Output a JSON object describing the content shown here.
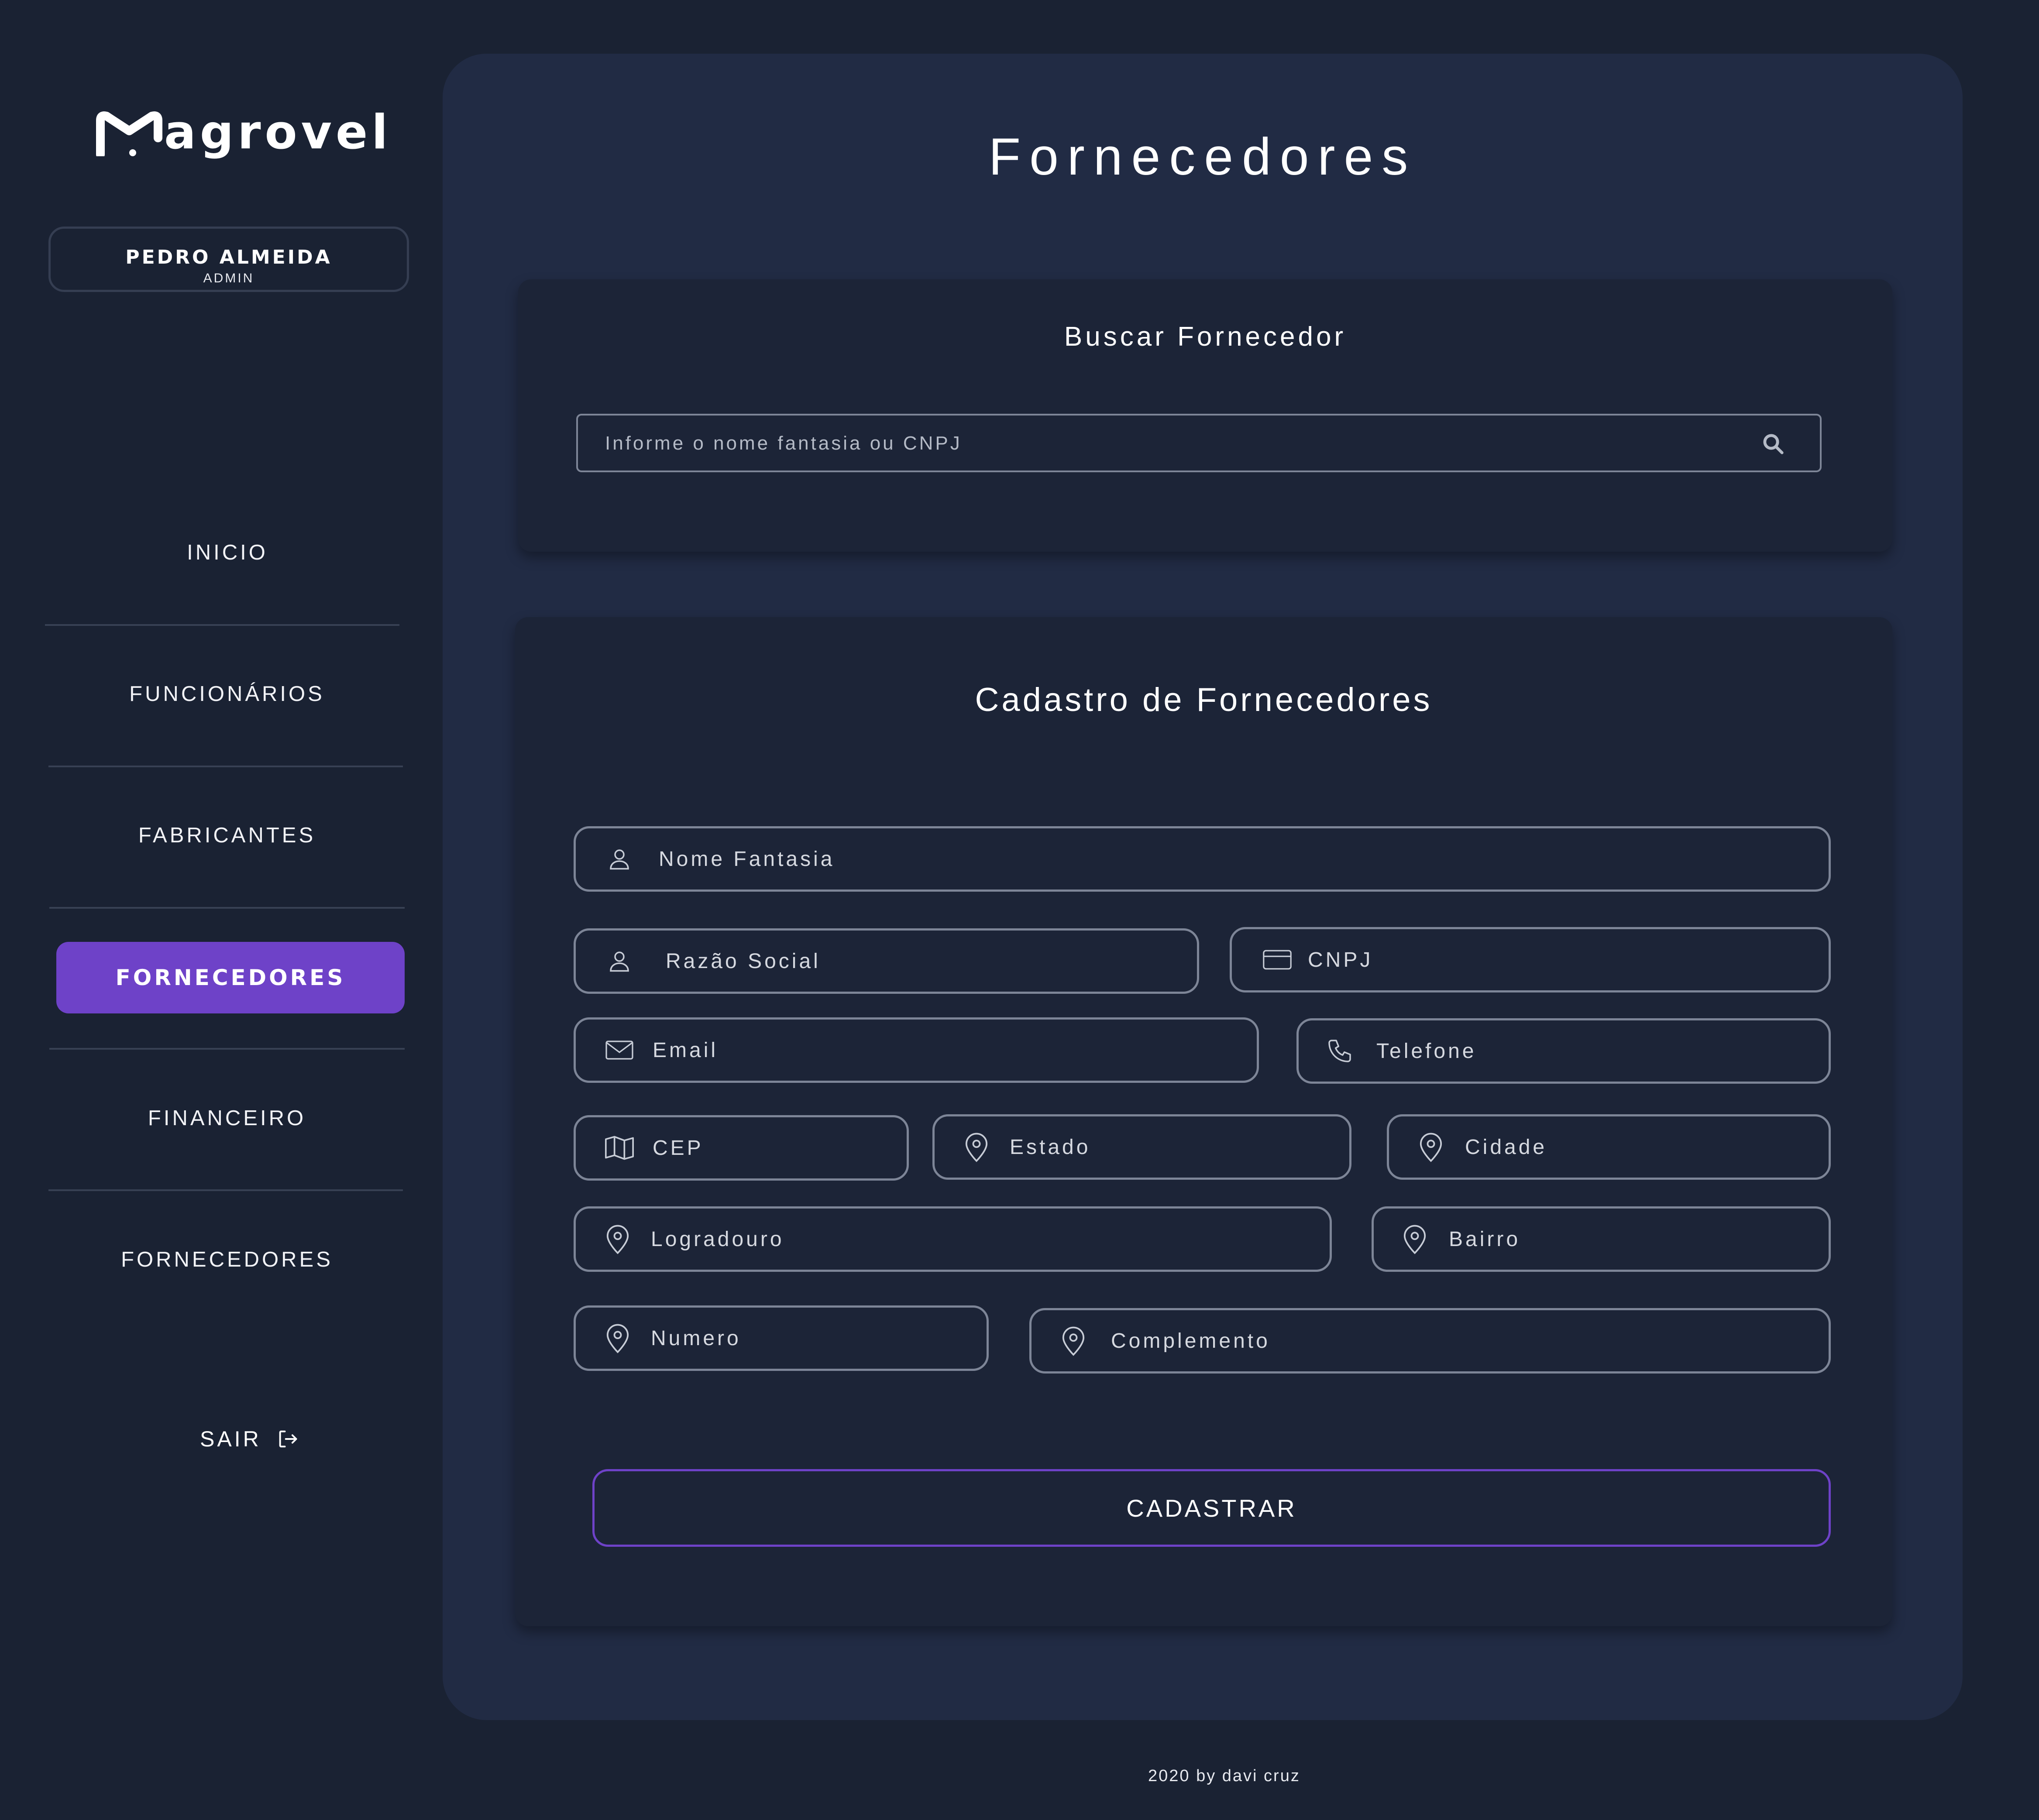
{
  "app": {
    "brand": "agrovel"
  },
  "user": {
    "name": "PEDRO ALMEIDA",
    "role": "ADMIN"
  },
  "sidebar": {
    "items": [
      {
        "label": "INICIO",
        "active": false
      },
      {
        "label": "FUNCIONÁRIOS",
        "active": false
      },
      {
        "label": "FABRICANTES",
        "active": false
      },
      {
        "label": "FORNECEDORES",
        "active": true
      },
      {
        "label": "FINANCEIRO",
        "active": false
      },
      {
        "label": "FORNECEDORES",
        "active": false
      }
    ],
    "logout_label": "SAIR",
    "active_color": "#6e42c8"
  },
  "page": {
    "title": "Fornecedores"
  },
  "search": {
    "title": "Buscar Fornecedor",
    "placeholder": "Informe o nome fantasia ou CNPJ",
    "value": ""
  },
  "form": {
    "title": "Cadastro de Fornecedores",
    "fields": {
      "nome_fantasia": {
        "placeholder": "Nome Fantasia",
        "icon": "user-icon"
      },
      "razao_social": {
        "placeholder": "Razão Social",
        "icon": "user-icon"
      },
      "cnpj": {
        "placeholder": "CNPJ",
        "icon": "card-icon"
      },
      "email": {
        "placeholder": "Email",
        "icon": "mail-icon"
      },
      "telefone": {
        "placeholder": "Telefone",
        "icon": "phone-icon"
      },
      "cep": {
        "placeholder": "CEP",
        "icon": "map-icon"
      },
      "estado": {
        "placeholder": "Estado",
        "icon": "location-pin-icon"
      },
      "cidade": {
        "placeholder": "Cidade",
        "icon": "location-pin-icon"
      },
      "logradouro": {
        "placeholder": "Logradouro",
        "icon": "location-pin-icon"
      },
      "bairro": {
        "placeholder": "Bairro",
        "icon": "location-pin-icon"
      },
      "numero": {
        "placeholder": "Numero",
        "icon": "location-pin-icon"
      },
      "complemento": {
        "placeholder": "Complemento",
        "icon": "location-pin-icon"
      }
    },
    "submit_label": "CADASTRAR",
    "accent": "#6e42c8"
  },
  "footer": {
    "text": "2020 by davi cruz"
  }
}
